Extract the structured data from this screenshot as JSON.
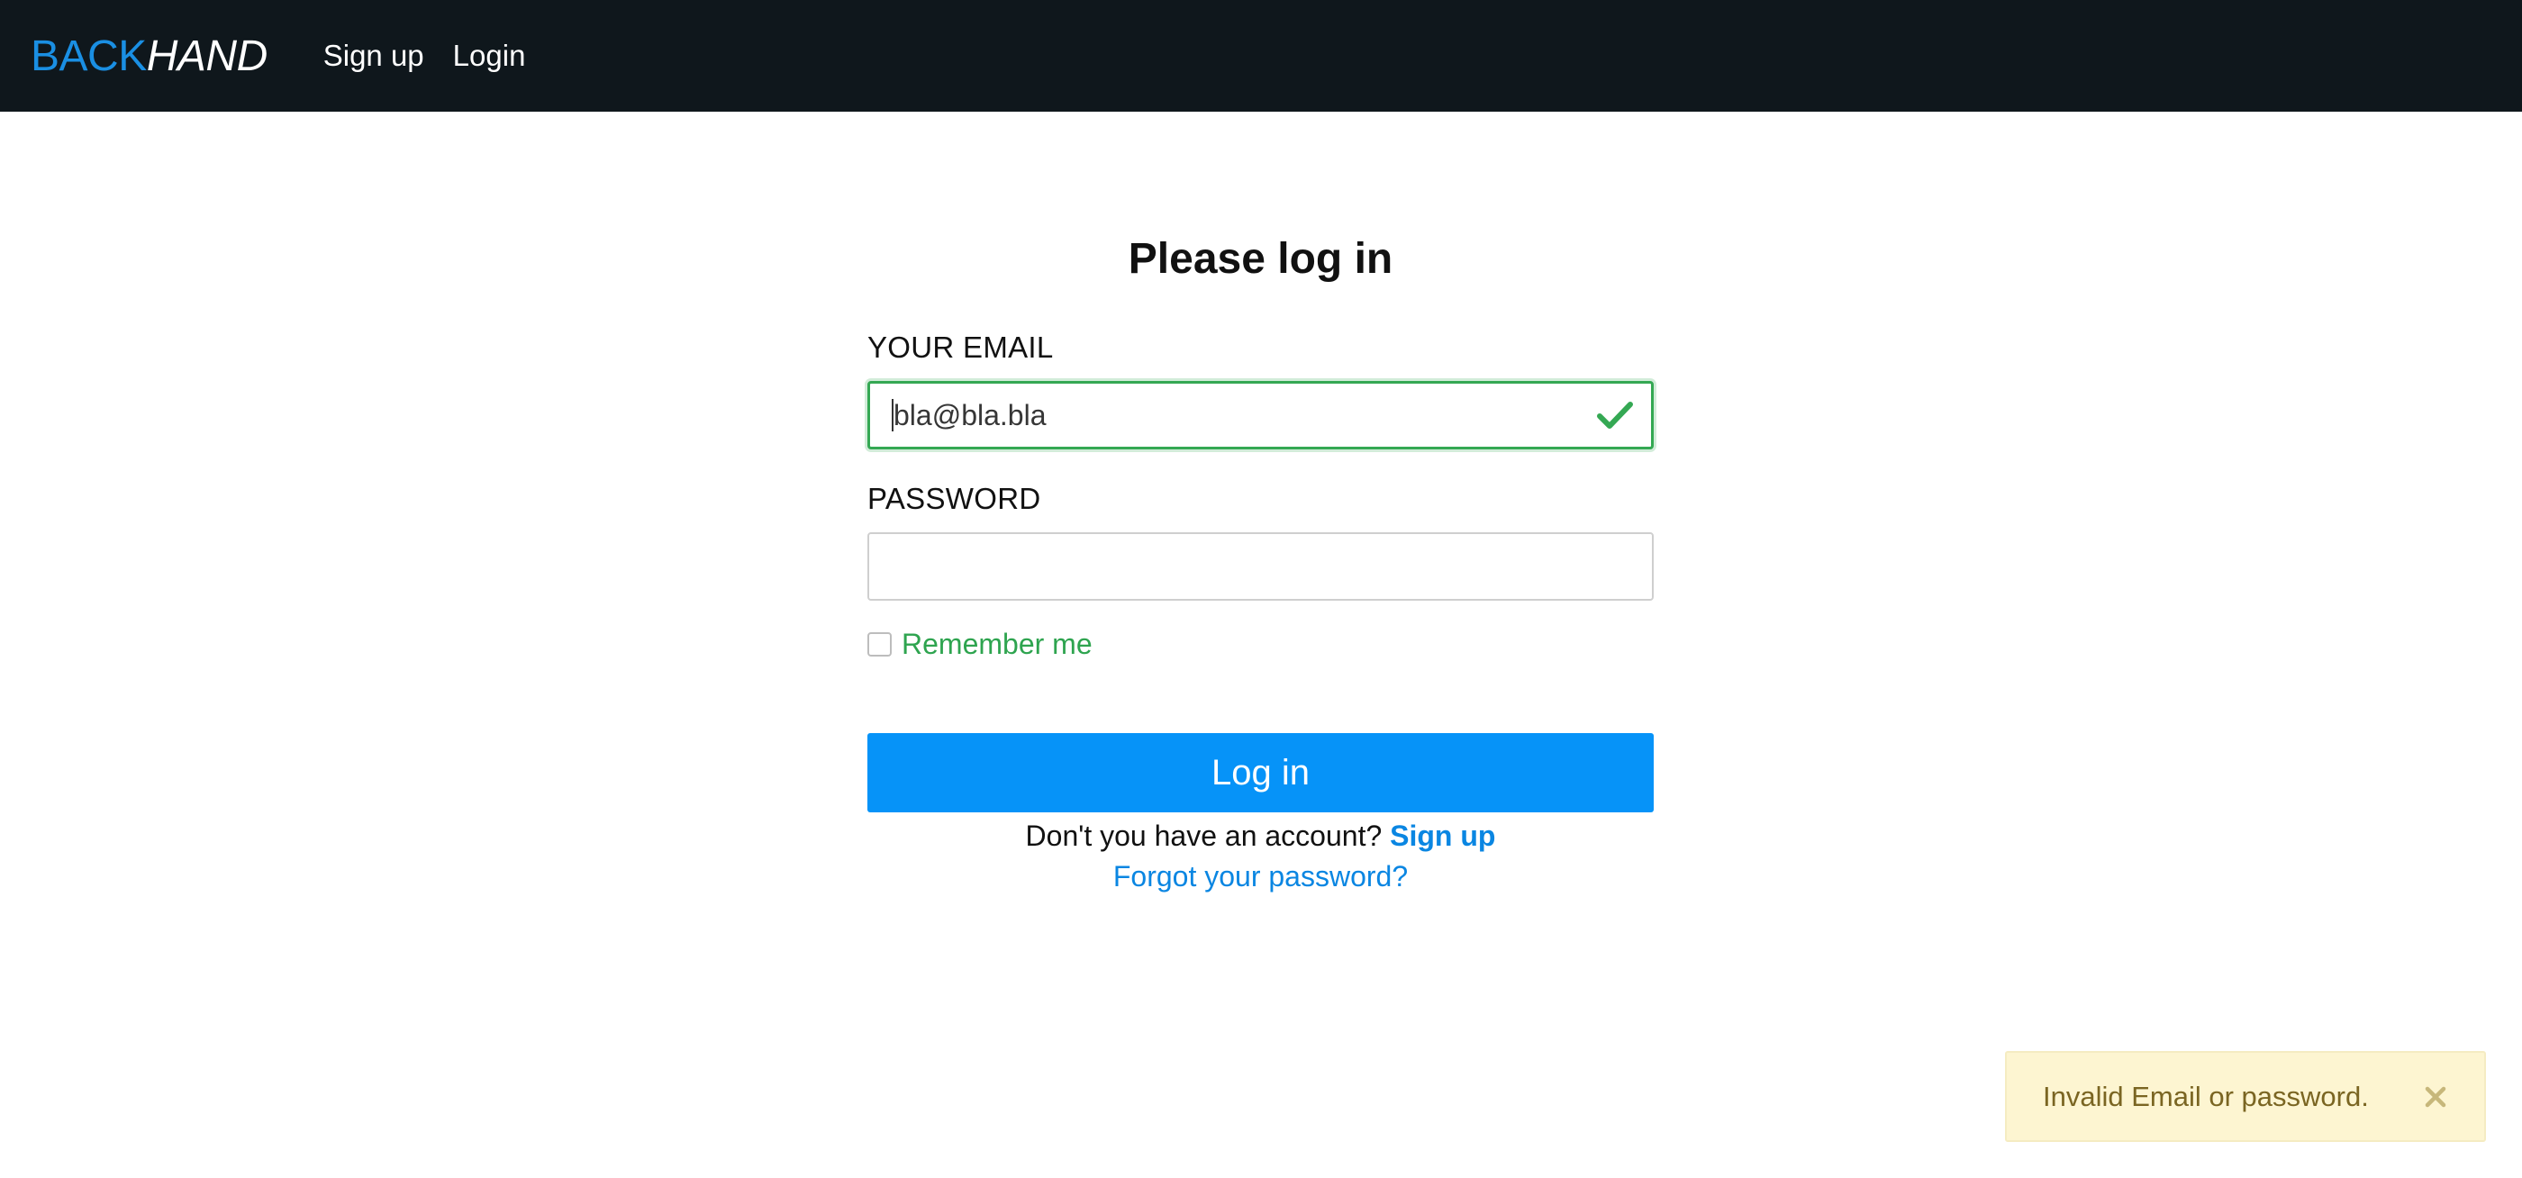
{
  "navbar": {
    "brand_part1": "BACK",
    "brand_part2": "HAND",
    "links": [
      "Sign up",
      "Login"
    ]
  },
  "form": {
    "title": "Please log in",
    "email_label": "YOUR EMAIL",
    "email_value": "bla@bla.bla",
    "password_label": "PASSWORD",
    "password_value": "",
    "remember_label": "Remember me",
    "remember_checked": false,
    "submit_label": "Log in",
    "signup_prompt": "Don't you have an account?",
    "signup_link": "Sign up",
    "forgot_link": "Forgot your password?"
  },
  "flash": {
    "message": "Invalid Email or password."
  },
  "icons": {
    "email_status": "check-icon",
    "flash_close": "close-icon"
  },
  "colors": {
    "navbar_bg": "#0f171c",
    "brand_blue": "#1a8fe3",
    "primary_button": "#0693f8",
    "link": "#0a86e2",
    "valid_green": "#34a853",
    "remember_green": "#2ea44f",
    "flash_bg": "#fdf5d1",
    "flash_text": "#7a6522"
  }
}
